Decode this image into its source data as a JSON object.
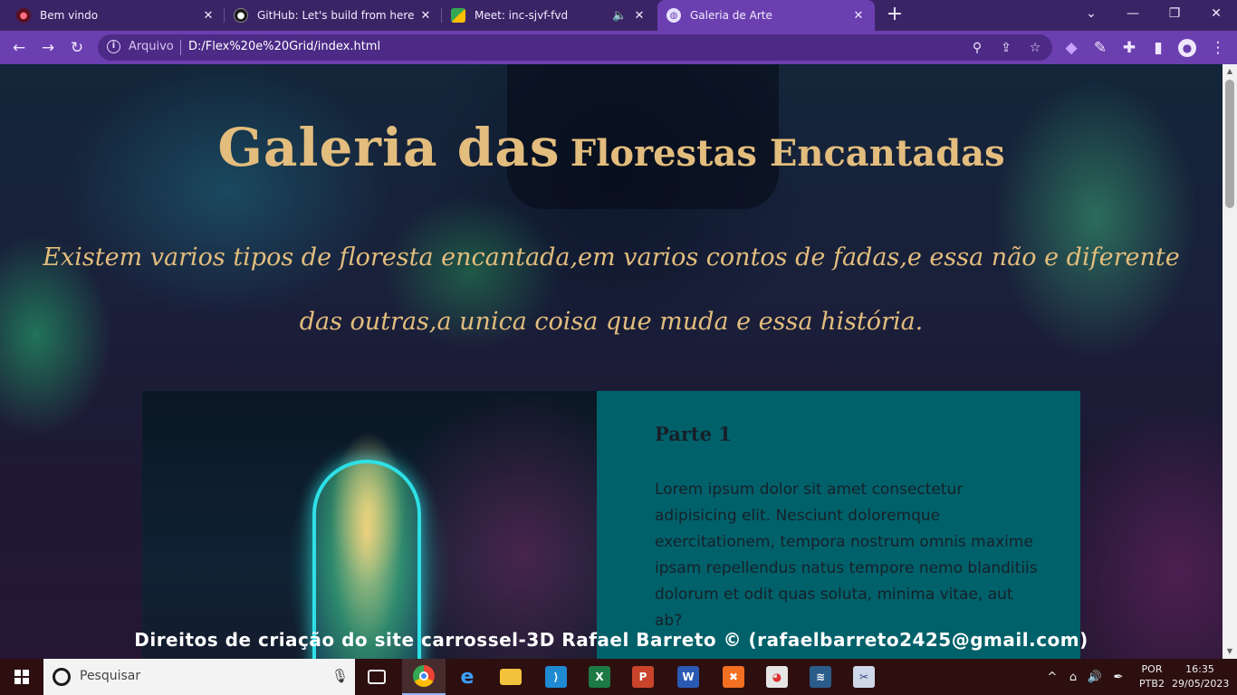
{
  "browser": {
    "tabs": [
      {
        "title": "Bem vindo",
        "active": false,
        "icon": "site-icon"
      },
      {
        "title": "GitHub: Let's build from here · GitHub",
        "active": false,
        "icon": "github-icon"
      },
      {
        "title": "Meet: inc-sjvf-fvd",
        "active": false,
        "icon": "meet-icon"
      },
      {
        "title": "Galeria de Arte",
        "active": true,
        "icon": "globe-icon"
      }
    ],
    "address": {
      "scheme_label": "Arquivo",
      "url": "D:/Flex%20e%20Grid/index.html"
    },
    "theme_color": "#6b3fb0"
  },
  "page": {
    "heading_big": "Galeria das",
    "heading_small": "Florestas Encantadas",
    "intro": "Existem varios tipos de floresta encantada,em varios contos de fadas,e essa não e diferente das outras,a unica coisa que muda e essa história.",
    "card": {
      "title": "Parte 1",
      "text": "Lorem ipsum dolor sit amet consectetur adipisicing elit. Nesciunt doloremque exercitationem, tempora nostrum omnis maxime ipsam repellendus natus tempore nemo blanditiis dolorum et odit quas soluta, minima vitae, aut ab?",
      "panel_color": "#00616a"
    },
    "footer": "Direitos de criação do site carrossel-3D Rafael Barreto © (rafaelbarreto2425@gmail.com)",
    "accent_color": "#e3bd7d"
  },
  "taskbar": {
    "search_placeholder": "Pesquisar",
    "apps": [
      "chrome-icon",
      "edge-icon",
      "file-explorer-icon",
      "vscode-icon",
      "excel-icon",
      "powerpoint-icon",
      "word-icon",
      "xampp-icon",
      "paint-icon",
      "sql-icon",
      "snipping-tool-icon"
    ],
    "language": "POR",
    "keyboard": "PTB2",
    "time": "16:35",
    "date": "29/05/2023"
  }
}
